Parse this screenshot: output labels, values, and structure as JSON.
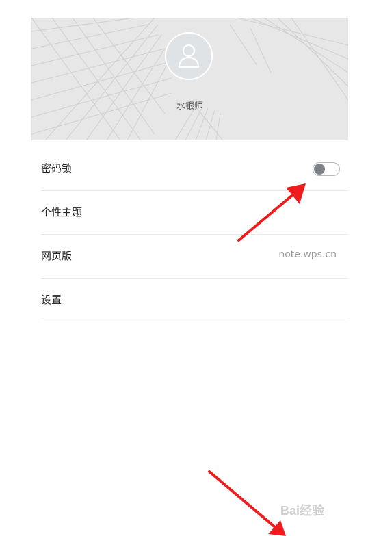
{
  "profile": {
    "username": "水银师"
  },
  "menu": {
    "items": [
      {
        "label": "密码锁",
        "toggle_on": false
      },
      {
        "label": "个性主题"
      },
      {
        "label": "网页版",
        "value": "note.wps.cn"
      },
      {
        "label": "设置"
      }
    ]
  },
  "watermark": {
    "text": "Bai经验"
  },
  "colors": {
    "header_bg": "#e7e7e7",
    "arrow": "#ee1c1c",
    "divider": "#e9e9e9"
  }
}
